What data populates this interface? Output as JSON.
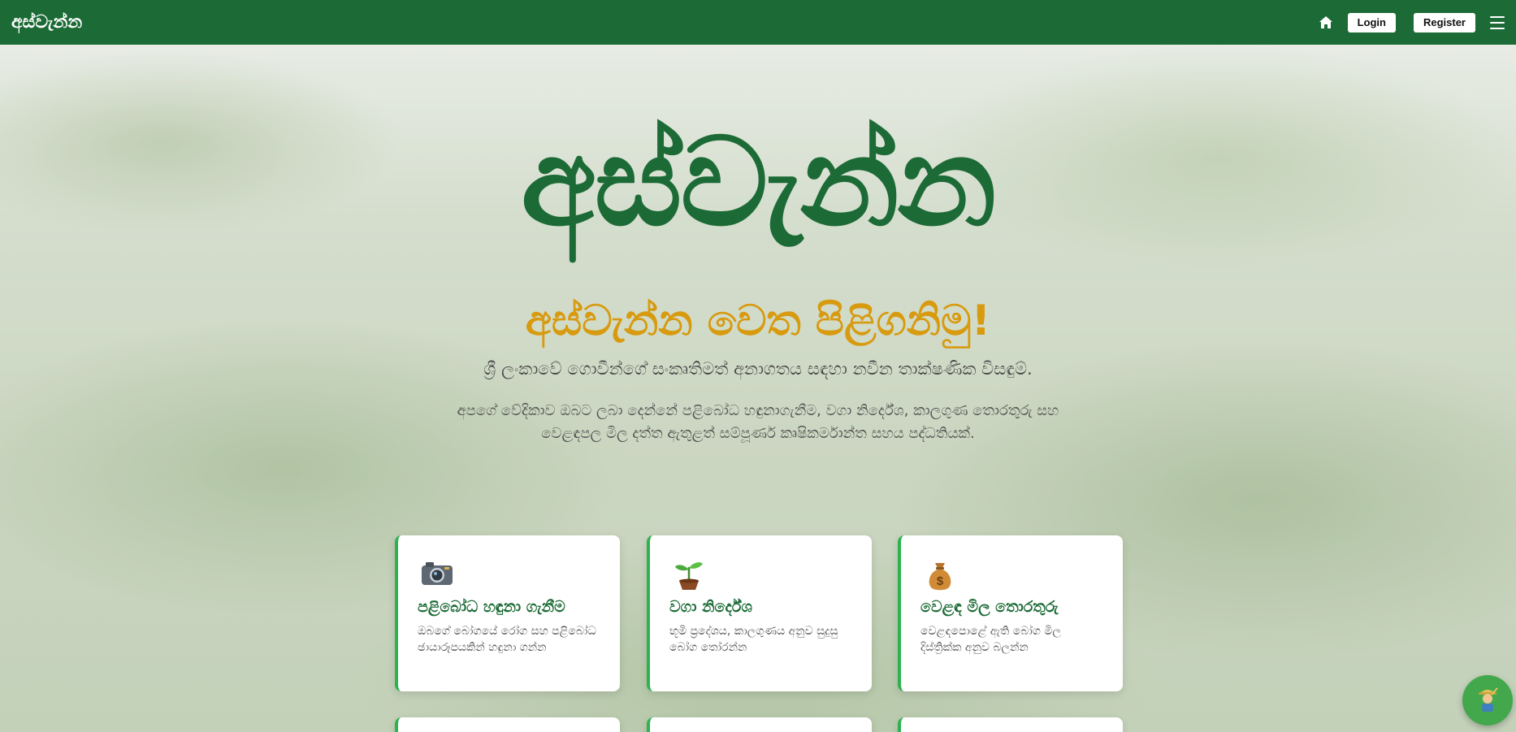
{
  "header": {
    "brand": "අස්වැන්න",
    "login_label": "Login",
    "register_label": "Register",
    "home_icon": "home-icon",
    "menu_icon": "hamburger-menu-icon"
  },
  "hero": {
    "title": "අස්වැන්න",
    "welcome": "අස්වැන්න වෙත පිළිගනිමු!",
    "tagline": "ශ්‍රී ලංකාවේ ගොවීන්ගේ සංකෘතිමත් අනාගතය සඳහා නවීන තාක්ෂණික විසඳුම්.",
    "description": "අපගේ වේදිකාව ඔබට ලබා දෙන්නේ පළිබෝධ හඳුනාගැනීම, වගා නිර්දේශ, කාලගුණ තොරතුරු සහ වෙළඳපල මිල දත්ත ඇතුළත් සම්පූර්ණ කෘෂිකර්මාන්ත සහය පද්ධතියක්."
  },
  "cards": [
    {
      "icon": "camera-icon",
      "title": "පළිබෝධ හඳුනා ගැනීම",
      "text": "ඔබගේ බෝගයේ රෝග සහ පළිබෝධ ඡායාරූපයකින් හඳුනා ගන්න"
    },
    {
      "icon": "seedling-icon",
      "title": "වගා නිර්දේශ",
      "text": "භූමි ප්‍රදේශය, කාලගුණය අනුව සුදුසු බෝග තෝරන්න"
    },
    {
      "icon": "money-bag-icon",
      "title": "වෙළඳ මිල තොරතුරු",
      "text": "වෙළඳපොළේ ඇති බෝග මිල දිස්ත්‍රික්ක අනුව බලන්න"
    }
  ],
  "chat_fab": {
    "icon": "farmer-chatbot-icon"
  },
  "colors": {
    "primary_green": "#1c6b36",
    "accent_gold": "#d89a0f",
    "card_border": "#2db24f"
  }
}
